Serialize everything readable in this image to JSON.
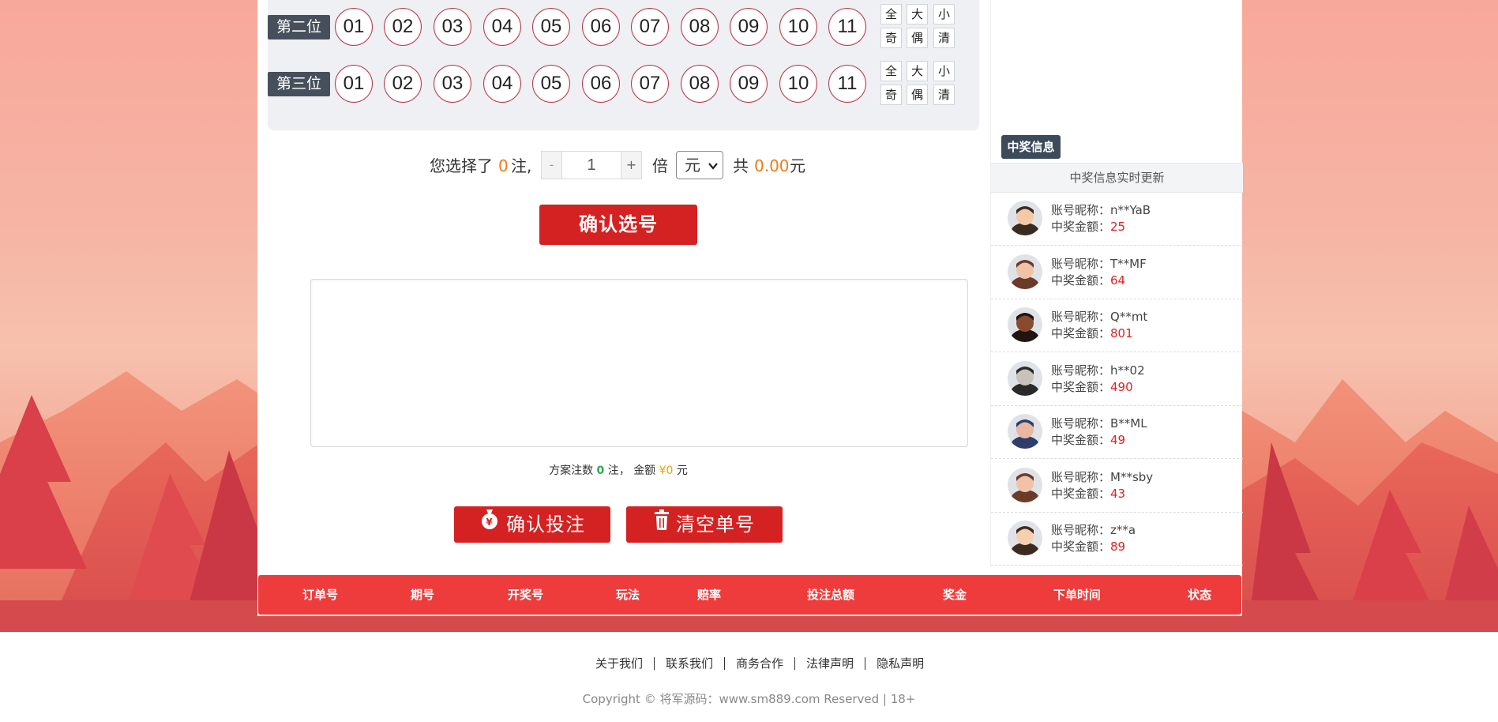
{
  "picker": {
    "rows": [
      {
        "label": "第二位",
        "balls": [
          "01",
          "02",
          "03",
          "04",
          "05",
          "06",
          "07",
          "08",
          "09",
          "10",
          "11"
        ],
        "quick": [
          "全",
          "大",
          "小",
          "奇",
          "偶",
          "清"
        ]
      },
      {
        "label": "第三位",
        "balls": [
          "01",
          "02",
          "03",
          "04",
          "05",
          "06",
          "07",
          "08",
          "09",
          "10",
          "11"
        ],
        "quick": [
          "全",
          "大",
          "小",
          "奇",
          "偶",
          "清"
        ]
      }
    ]
  },
  "bet": {
    "prefix": "您选择了",
    "count": "0",
    "count_unit": "注,",
    "minus": "-",
    "multiplier": "1",
    "plus": "+",
    "times_label": "倍",
    "unit": "元",
    "total_label": "共",
    "total": "0.00",
    "total_unit": "元"
  },
  "confirm_pick_label": "确认选号",
  "summary": {
    "label": "方案注数",
    "count": "0",
    "count_unit": "注，",
    "amount_label": "金额",
    "amount": "¥0",
    "amount_unit": "元"
  },
  "actions": {
    "confirm_bet": "确认投注",
    "clear": "清空单号"
  },
  "sidebar": {
    "tag": "中奖信息",
    "subtitle": "中奖信息实时更新",
    "nick_label": "账号昵称：",
    "amount_label": "中奖金额：",
    "winners": [
      {
        "nick": "n**YaB",
        "amount": "25"
      },
      {
        "nick": "T**MF",
        "amount": "64"
      },
      {
        "nick": "Q**mt",
        "amount": "801"
      },
      {
        "nick": "h**02",
        "amount": "490"
      },
      {
        "nick": "B**ML",
        "amount": "49"
      },
      {
        "nick": "M**sby",
        "amount": "43"
      },
      {
        "nick": "z**a",
        "amount": "89"
      }
    ]
  },
  "table": {
    "headers": [
      "订单号",
      "期号",
      "开奖号",
      "玩法",
      "赔率",
      "投注总额",
      "奖金",
      "下单时间",
      "状态"
    ]
  },
  "footer": {
    "links": [
      "关于我们",
      "联系我们",
      "商务合作",
      "法律声明",
      "隐私声明"
    ],
    "copyright": "Copyright © 将军源码：www.sm889.com Reserved | 18+"
  },
  "colors": {
    "accent_red": "#d42121",
    "table_header_red": "#ee3c3c",
    "label_dark": "#46505c",
    "highlight_orange": "#f07a1c"
  }
}
